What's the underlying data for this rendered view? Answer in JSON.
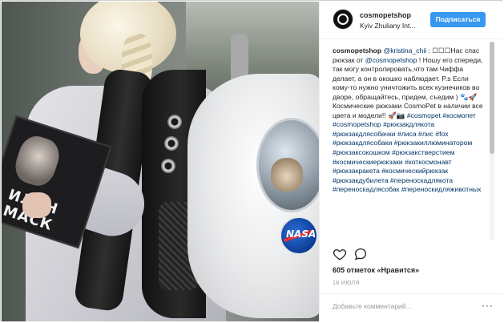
{
  "post": {
    "username": "cosmopetshop",
    "location": "Kyiv Zhuliany Int...",
    "follow_label": "Подписаться",
    "caption": {
      "author": "cosmopetshop",
      "mention1": "@kristina_chii",
      "text1": " : ☐☐☐Нас спас рюкзак от ",
      "mention2": "@cosmopetshop",
      "text2": " ! Ношу его спереди, так могу контролировать,что там Чиффа делает, а он в окошко наблюдает. P.s Если кому-то нужно уничтожить всех кузнечиков во дворе, обращайтесь, придем, съедим ) 🐾🚀 Космические рюкзаки CosmoPet в наличии все цвета и модели!! 🚀📷",
      "hashtags": [
        "#cosmopet",
        "#космопет",
        "#cosmopetshop",
        "#рюкзакдлякота",
        "#рюкзакдлясобачки",
        "#лиса",
        "#лис",
        "#fox",
        "#рюкзакдлясобаки",
        "#рюкзакиллюминатором",
        "#рюкзаксокошком",
        "#рюкзакстверстием",
        "#космическиерюкзаки",
        "#коткосмонавт",
        "#рюкзакракета",
        "#космическийрюкзак",
        "#рюкзакдубилета",
        "#переноскадлякота",
        "#переноскадлясобак",
        "#переноскидляживотных"
      ]
    },
    "likes_text": "605 отметок «Нравится»",
    "date": "18 ИЮЛЯ",
    "comment_placeholder": "Добавьте комментарий...",
    "more_label": "···",
    "photo": {
      "book_title": "ИЛОН МАСК",
      "backpack_logo": "NASA"
    }
  },
  "icons": {
    "like": "heart-icon",
    "comment": "speech-bubble-icon",
    "avatar": "cosmopetshop-logo",
    "more": "ellipsis-icon"
  },
  "colors": {
    "follow_button": "#3897f0",
    "hashtag": "#003569",
    "text": "#262626",
    "muted": "#999999"
  }
}
